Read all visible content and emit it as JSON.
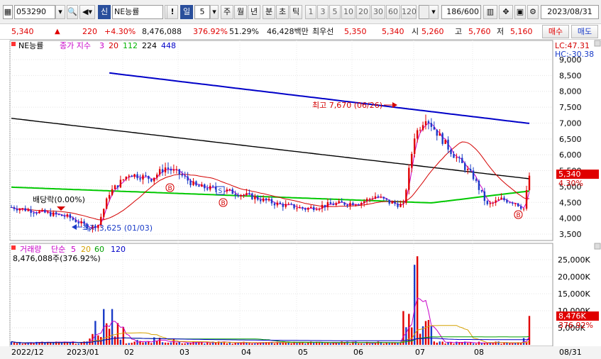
{
  "toolbar": {
    "code": "053290",
    "market_tag": "신",
    "stock_name": "NE능률",
    "period_active": "일",
    "period_num": "5",
    "periods": [
      "주",
      "월",
      "년",
      "분",
      "초",
      "틱"
    ],
    "intervals": [
      "1",
      "3",
      "5",
      "10",
      "20",
      "30",
      "60",
      "120"
    ],
    "count": "186/600",
    "date": "2023/08/31"
  },
  "quote": {
    "price": "5,340",
    "arrow": "▲",
    "change": "220",
    "change_pct": "+4.30%",
    "volume": "8,476,088",
    "volume_ratio": "376.92%",
    "ratio2": "51.29%",
    "amount": "46,428백만",
    "label_best": "최우선",
    "best_bid": "5,350",
    "best_ask": "5,340",
    "open_label": "시",
    "open": "5,260",
    "high_label": "고",
    "high": "5,760",
    "low_label": "저",
    "low": "5,160",
    "buy_label": "매수",
    "sell_label": "매도"
  },
  "price_panel": {
    "name_label": "NE능률",
    "legend_title": "종가 지수",
    "legend_periods": [
      "3",
      "20",
      "112",
      "224",
      "448"
    ],
    "legend_colors": [
      "#c800c8",
      "#d40000",
      "#00b400",
      "#000000",
      "#0000c8"
    ],
    "lc_label": "LC:47.31",
    "hc_label": "HC:-30.38",
    "y_ticks": [
      "9,000",
      "8,500",
      "8,000",
      "7,500",
      "7,000",
      "6,500",
      "6,000",
      "5,500",
      "5,000",
      "4,500",
      "4,000",
      "3,500"
    ],
    "current_price_tag": "5,340",
    "current_pct_tag": "4.30%",
    "annotations": {
      "high_note": "최고 7,670 (06/26)",
      "low_note": "최저 3,625 (01/03)",
      "dividend_note": "배당락(0.00%)"
    },
    "markers": [
      "B",
      "S",
      "B",
      "B"
    ]
  },
  "volume_panel": {
    "legend_title": "거래량",
    "legend_type": "단순",
    "legend_periods": [
      "5",
      "20",
      "60",
      "120"
    ],
    "legend_colors": [
      "#c800c8",
      "#d4a000",
      "#00a000",
      "#0000c8"
    ],
    "volume_readout": "8,476,088주(376.92%)",
    "y_ticks": [
      "25,000K",
      "20,000K",
      "15,000K",
      "10,000K",
      "5,000K"
    ],
    "current_volume_tag": "8,476K",
    "current_pct_tag": "376.92%"
  },
  "x_axis": {
    "labels": [
      "2022/12",
      "2023/01",
      "02",
      "03",
      "04",
      "05",
      "06",
      "07",
      "08"
    ],
    "right_label": "08/31"
  },
  "colors": {
    "up": "#e00000",
    "down": "#1a3cc8",
    "ma3": "#c800c8",
    "ma20": "#d40000",
    "ma112": "#00c800",
    "ma224": "#000000",
    "ma448": "#0000c8"
  }
}
